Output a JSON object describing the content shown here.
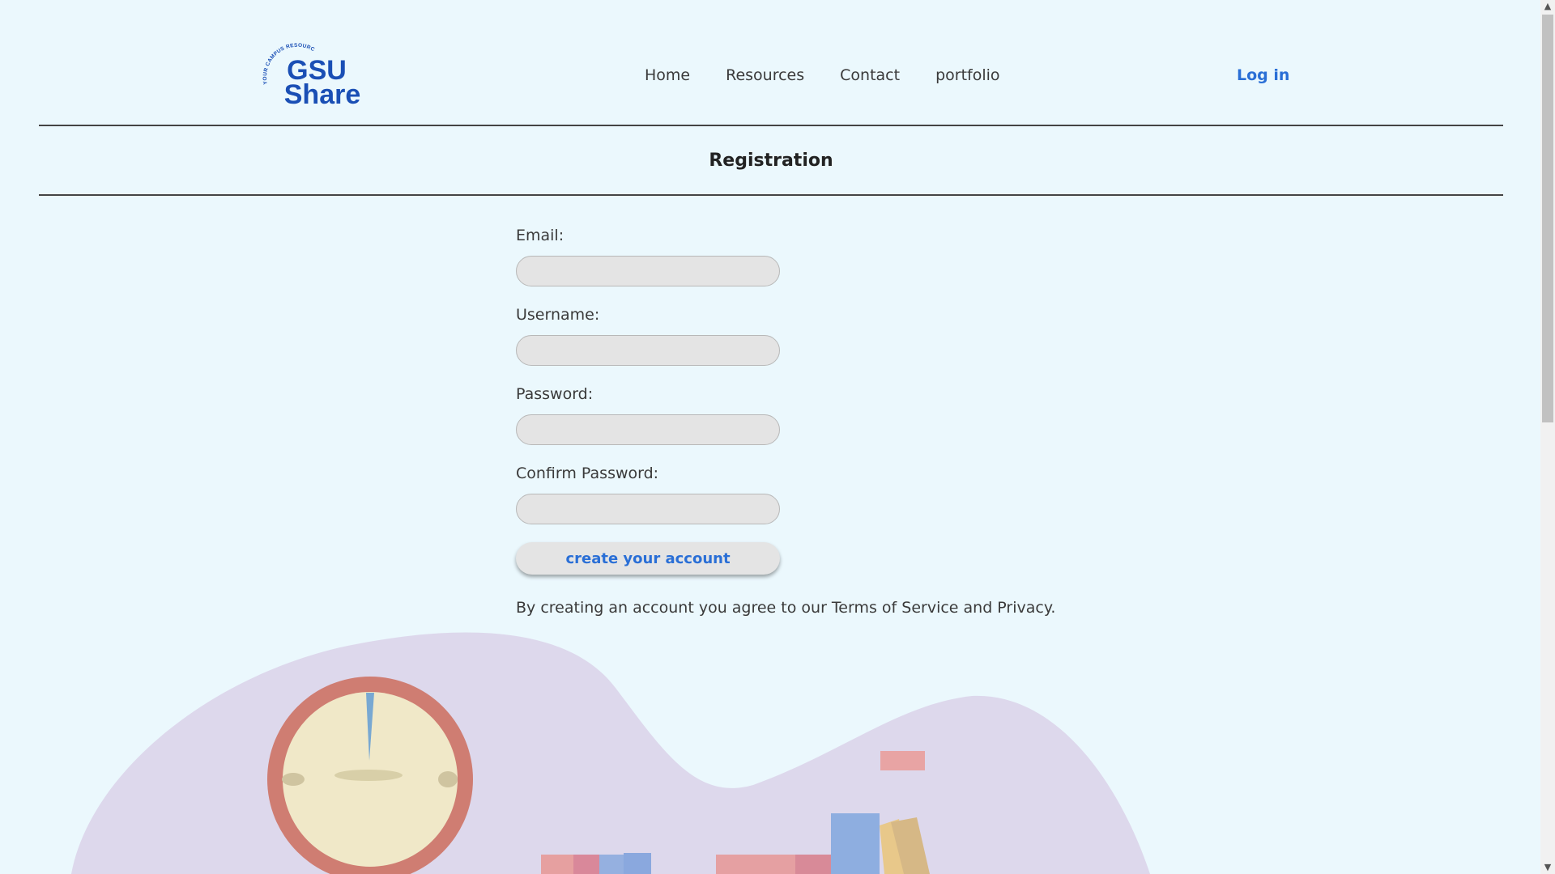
{
  "header": {
    "logo": {
      "main_line1": "GSU",
      "main_line2": "Share",
      "tagline": "YOUR CAMPUS RESOURCE SOLUTION"
    },
    "nav": [
      {
        "label": "Home"
      },
      {
        "label": "Resources"
      },
      {
        "label": "Contact"
      },
      {
        "label": "portfolio"
      }
    ],
    "login_label": "Log in"
  },
  "page_title": "Registration",
  "form": {
    "fields": [
      {
        "label": "Email:",
        "value": "",
        "placeholder": ""
      },
      {
        "label": "Username:",
        "value": "",
        "placeholder": ""
      },
      {
        "label": "Password:",
        "value": "",
        "placeholder": ""
      },
      {
        "label": "Confirm Password:",
        "value": "",
        "placeholder": ""
      }
    ],
    "submit_label": "create your account",
    "terms_text": "By creating an account you agree to our Terms of Service and Privacy."
  },
  "colors": {
    "background": "#ebf8fd",
    "accent": "#2a6fd6",
    "logo": "#1a4fb5",
    "input_bg": "#e4e4e4"
  },
  "icons": {
    "scroll_up": "chevron-up-icon",
    "scroll_down": "chevron-down-icon"
  }
}
